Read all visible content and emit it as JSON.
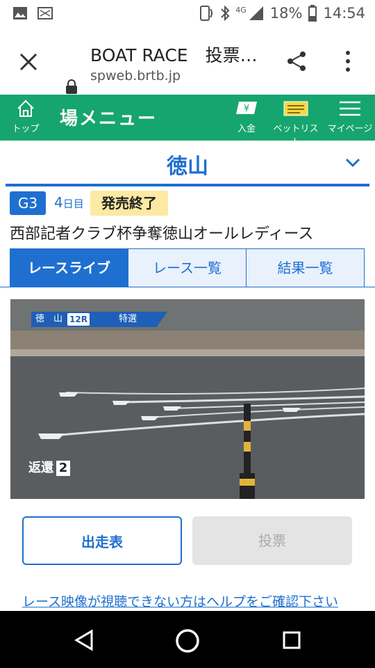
{
  "status_bar": {
    "left_icons": [
      "gallery-icon",
      "cast-icon"
    ],
    "network": "4G",
    "battery": "18%",
    "time": "14:54"
  },
  "browser": {
    "title": "BOAT RACE　投票…",
    "host": "spweb.brtb.jp"
  },
  "nav": {
    "home": "トップ",
    "menu": "場メニュー",
    "deposit": "入金",
    "betlist": "ベットリスト",
    "mypage": "マイページ"
  },
  "venue": {
    "name": "徳山"
  },
  "race": {
    "grade": "G3",
    "day_num": "4",
    "day_unit": "日目",
    "sales_status": "発売終了",
    "title": "西部記者クラブ杯争奪徳山オールレディース"
  },
  "tabs": [
    {
      "label": "レースライブ",
      "active": true
    },
    {
      "label": "レース一覧",
      "active": false
    },
    {
      "label": "結果一覧",
      "active": false
    }
  ],
  "video": {
    "overlay_venue": "徳　山",
    "overlay_race": "12R",
    "overlay_class": "特選",
    "lap_label": "返還",
    "lap_num": "2"
  },
  "buttons": {
    "entry": "出走表",
    "vote": "投票"
  },
  "help_link": "レース映像が視聴できない方はヘルプをご確認下さい",
  "colors": {
    "brand_green": "#16a56e",
    "accent_blue": "#1f6fd0",
    "badge_yellow": "#fbe9a4"
  }
}
